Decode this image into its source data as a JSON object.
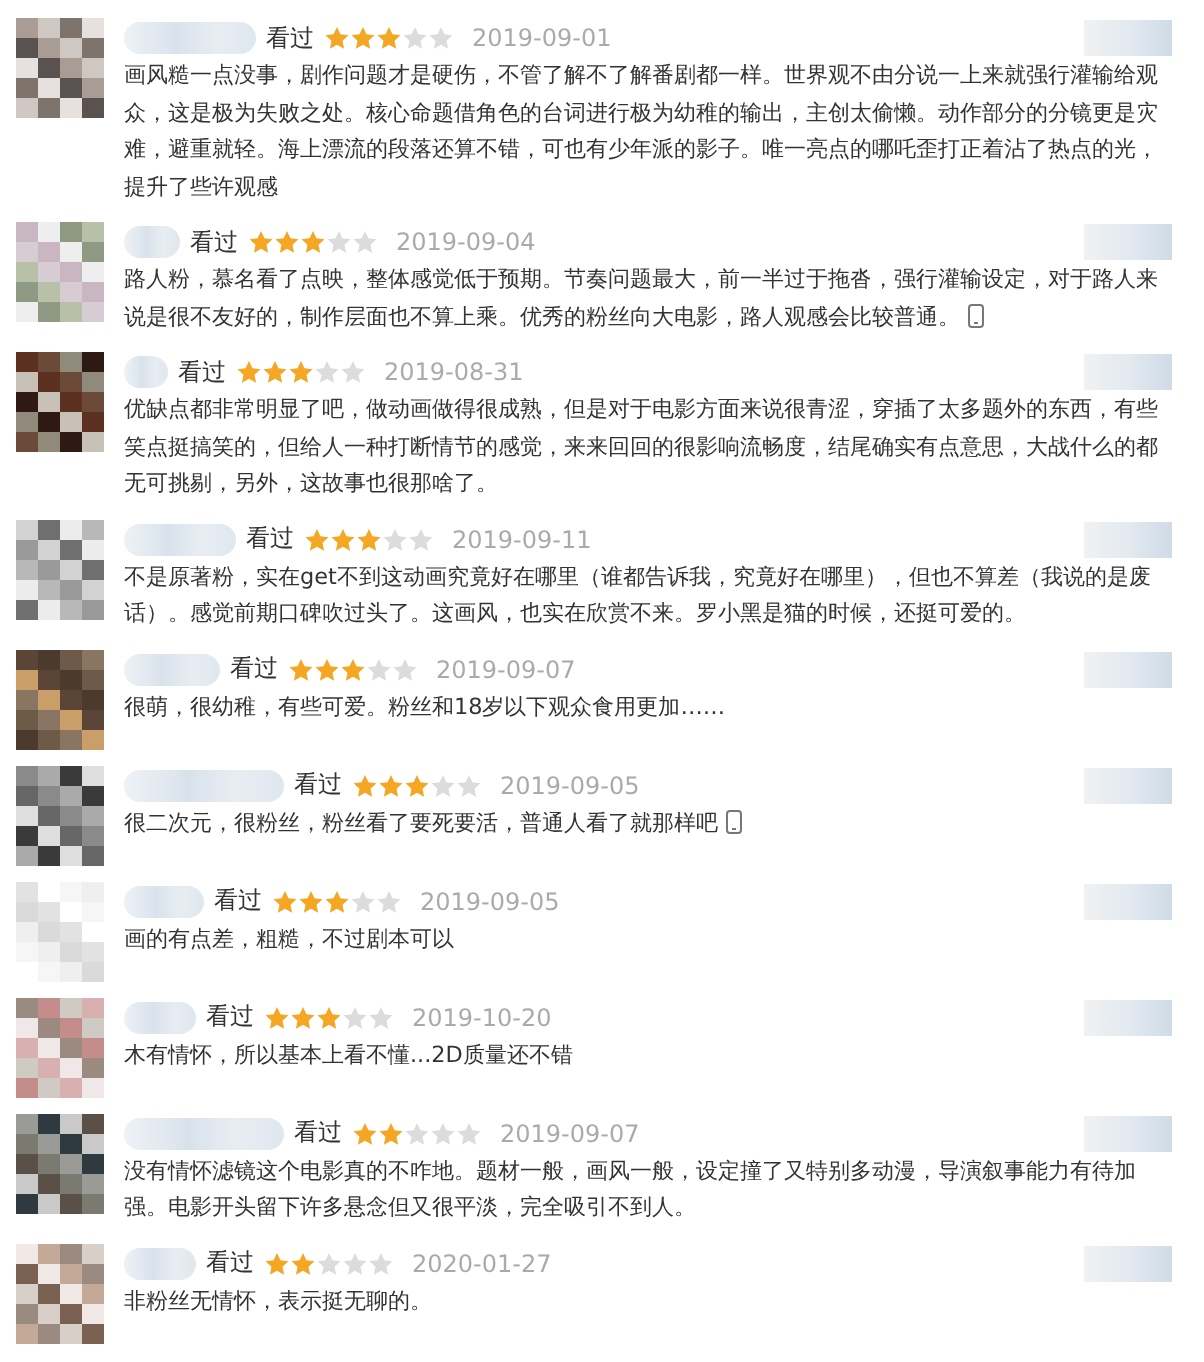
{
  "comments": [
    {
      "status": "看过",
      "stars": 3,
      "date": "2019-09-01",
      "text": "画风糙一点没事，剧作问题才是硬伤，不管了解不了解番剧都一样。世界观不由分说一上来就强行灌输给观众，这是极为失败之处。核心命题借角色的台词进行极为幼稚的输出，主创太偷懒。动作部分的分镜更是灾难，避重就轻。海上漂流的段落还算不错，可也有少年派的影子。唯一亮点的哪吒歪打正着沾了热点的光，提升了些许观感",
      "mobile": false
    },
    {
      "status": "看过",
      "stars": 3,
      "date": "2019-09-04",
      "text": "路人粉，慕名看了点映，整体感觉低于预期。节奏问题最大，前一半过于拖沓，强行灌输设定，对于路人来说是很不友好的，制作层面也不算上乘。优秀的粉丝向大电影，路人观感会比较普通。",
      "mobile": true
    },
    {
      "status": "看过",
      "stars": 3,
      "date": "2019-08-31",
      "text": "优缺点都非常明显了吧，做动画做得很成熟，但是对于电影方面来说很青涩，穿插了太多题外的东西，有些笑点挺搞笑的，但给人一种打断情节的感觉，来来回回的很影响流畅度，结尾确实有点意思，大战什么的都无可挑剔，另外，这故事也很那啥了。",
      "mobile": false
    },
    {
      "status": "看过",
      "stars": 3,
      "date": "2019-09-11",
      "text": "不是原著粉，实在get不到这动画究竟好在哪里（谁都告诉我，究竟好在哪里），但也不算差（我说的是废话）。感觉前期口碑吹过头了。这画风，也实在欣赏不来。罗小黑是猫的时候，还挺可爱的。",
      "mobile": false
    },
    {
      "status": "看过",
      "stars": 3,
      "date": "2019-09-07",
      "text": "很萌，很幼稚，有些可爱。粉丝和18岁以下观众食用更加……",
      "mobile": false
    },
    {
      "status": "看过",
      "stars": 3,
      "date": "2019-09-05",
      "text": "很二次元，很粉丝，粉丝看了要死要活，普通人看了就那样吧",
      "mobile": true
    },
    {
      "status": "看过",
      "stars": 3,
      "date": "2019-09-05",
      "text": "画的有点差，粗糙，不过剧本可以",
      "mobile": false
    },
    {
      "status": "看过",
      "stars": 3,
      "date": "2019-10-20",
      "text": "木有情怀，所以基本上看不懂...2D质量还不错",
      "mobile": false
    },
    {
      "status": "看过",
      "stars": 2,
      "date": "2019-09-07",
      "text": "没有情怀滤镜这个电影真的不咋地。题材一般，画风一般，设定撞了又特别多动漫，导演叙事能力有待加强。电影开头留下许多悬念但又很平淡，完全吸引不到人。",
      "mobile": false
    },
    {
      "status": "看过",
      "stars": 2,
      "date": "2020-01-27",
      "text": "非粉丝无情怀，表示挺无聊的。",
      "mobile": false
    }
  ]
}
